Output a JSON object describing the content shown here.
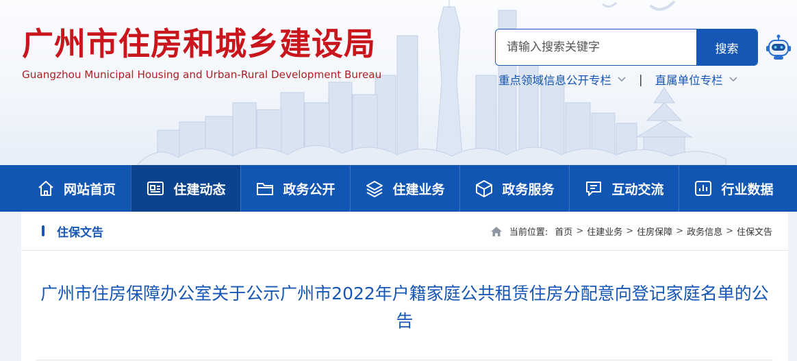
{
  "header": {
    "title": "广州市住房和城乡建设局",
    "subtitle": "Guangzhou Municipal Housing and Urban-Rural Development Bureau"
  },
  "search": {
    "placeholder": "请输入搜索关键字",
    "value": "",
    "button_label": "搜索"
  },
  "quicklinks": {
    "items": [
      {
        "label": "重点领域信息公开专栏"
      },
      {
        "label": "直属单位专栏"
      }
    ],
    "separator": "|"
  },
  "nav": {
    "items": [
      {
        "label": "网站首页",
        "icon": "home-icon",
        "active": false
      },
      {
        "label": "住建动态",
        "icon": "news-icon",
        "active": true
      },
      {
        "label": "政务公开",
        "icon": "folder-icon",
        "active": false
      },
      {
        "label": "住建业务",
        "icon": "layers-icon",
        "active": false
      },
      {
        "label": "政务服务",
        "icon": "box-icon",
        "active": false
      },
      {
        "label": "互动交流",
        "icon": "chat-icon",
        "active": false
      },
      {
        "label": "行业数据",
        "icon": "bar-chart-icon",
        "active": false
      }
    ]
  },
  "section": {
    "title": "住保文告"
  },
  "breadcrumb": {
    "label": "当前位置:",
    "items": [
      "首页",
      "住建业务",
      "住房保障",
      "政务信息",
      "住保文告"
    ],
    "separator": ">"
  },
  "article": {
    "title": "广州市住房保障办公室关于公示广州市2022年户籍家庭公共租赁住房分配意向登记家庭名单的公告"
  },
  "colors": {
    "brand_red": "#c9161d",
    "brand_blue": "#1656b4",
    "nav_bg": "#1256b4",
    "nav_active": "#0c438f"
  }
}
